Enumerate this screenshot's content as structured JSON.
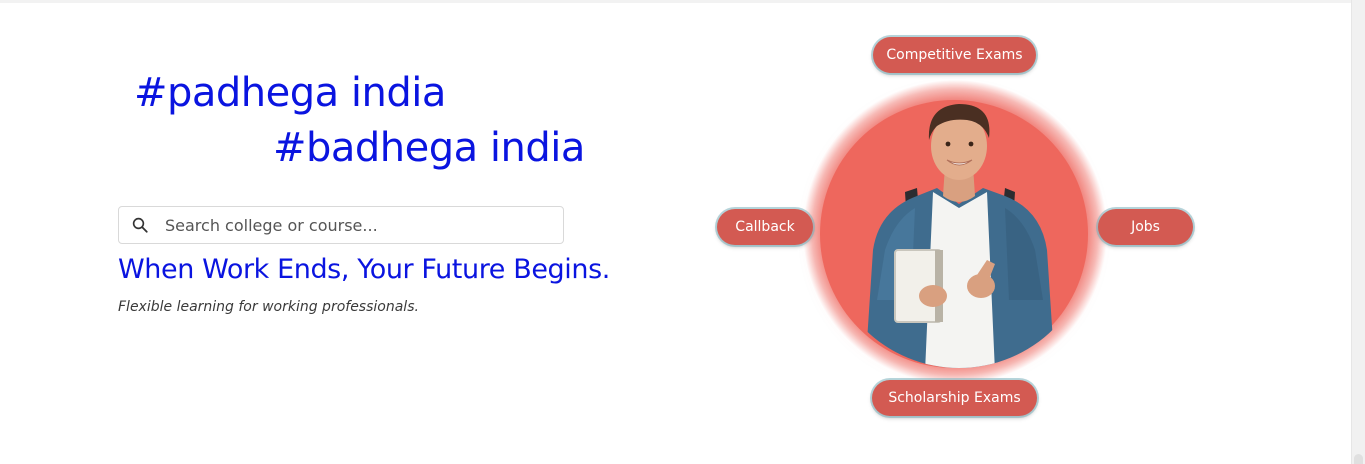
{
  "hero": {
    "tagline_1": "#padhega india",
    "tagline_2": "#badhega india",
    "headline": "When Work Ends, Your Future Begins.",
    "subheadline": "Flexible learning for working professionals."
  },
  "search": {
    "placeholder": "Search college or course...",
    "icon": "search-icon"
  },
  "orbit": {
    "items": [
      "Competitive Exams",
      "Callback",
      "Jobs",
      "Scholarship Exams"
    ]
  },
  "colors": {
    "accent_blue": "#0a14e0",
    "pill_red": "#d35a52",
    "circle_inner": "#ee675d",
    "circle_outer": "#f28b84"
  }
}
